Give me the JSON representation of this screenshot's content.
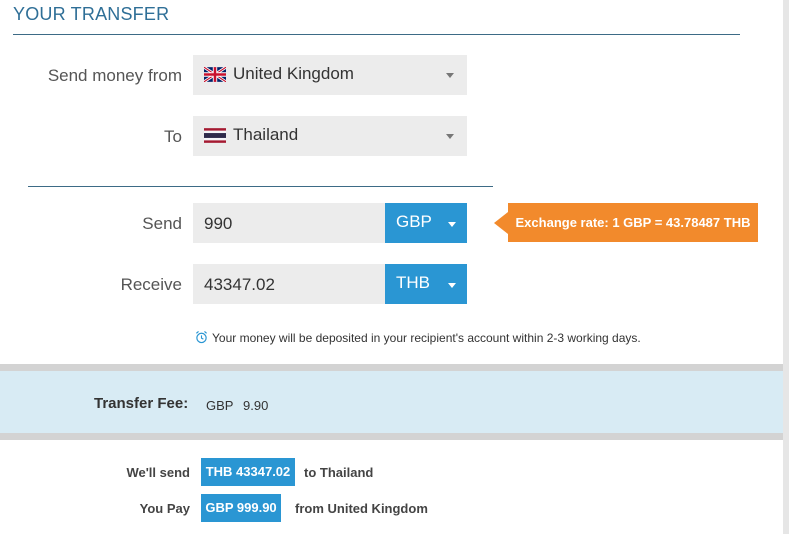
{
  "header": {
    "title": "YOUR TRANSFER"
  },
  "form": {
    "from_label": "Send money from",
    "from_country": "United Kingdom",
    "to_label": "To",
    "to_country": "Thailand",
    "send_label": "Send",
    "send_value": "990",
    "send_currency": "GBP",
    "receive_label": "Receive",
    "receive_value": "43347.02",
    "receive_currency": "THB"
  },
  "rate": {
    "text": "Exchange rate: 1 GBP = 43.78487 THB"
  },
  "notice": {
    "text": "Your money will be deposited in your recipient's account within 2-3 working days."
  },
  "fee": {
    "label": "Transfer Fee:",
    "currency": "GBP",
    "value": "9.90"
  },
  "summary": {
    "send_label": "We'll send",
    "send_amount": "THB 43347.02",
    "send_dest": "to Thailand",
    "pay_label": "You Pay",
    "pay_amount": "GBP 999.90",
    "pay_source": "from United Kingdom"
  },
  "colors": {
    "accent": "#2a96d3",
    "rate_tag": "#f28a2c",
    "fee_band": "#d8ebf4",
    "title": "#2f6f97"
  },
  "icons": [
    "uk-flag-icon",
    "thailand-flag-icon",
    "chevron-down-icon",
    "alarm-clock-icon"
  ]
}
